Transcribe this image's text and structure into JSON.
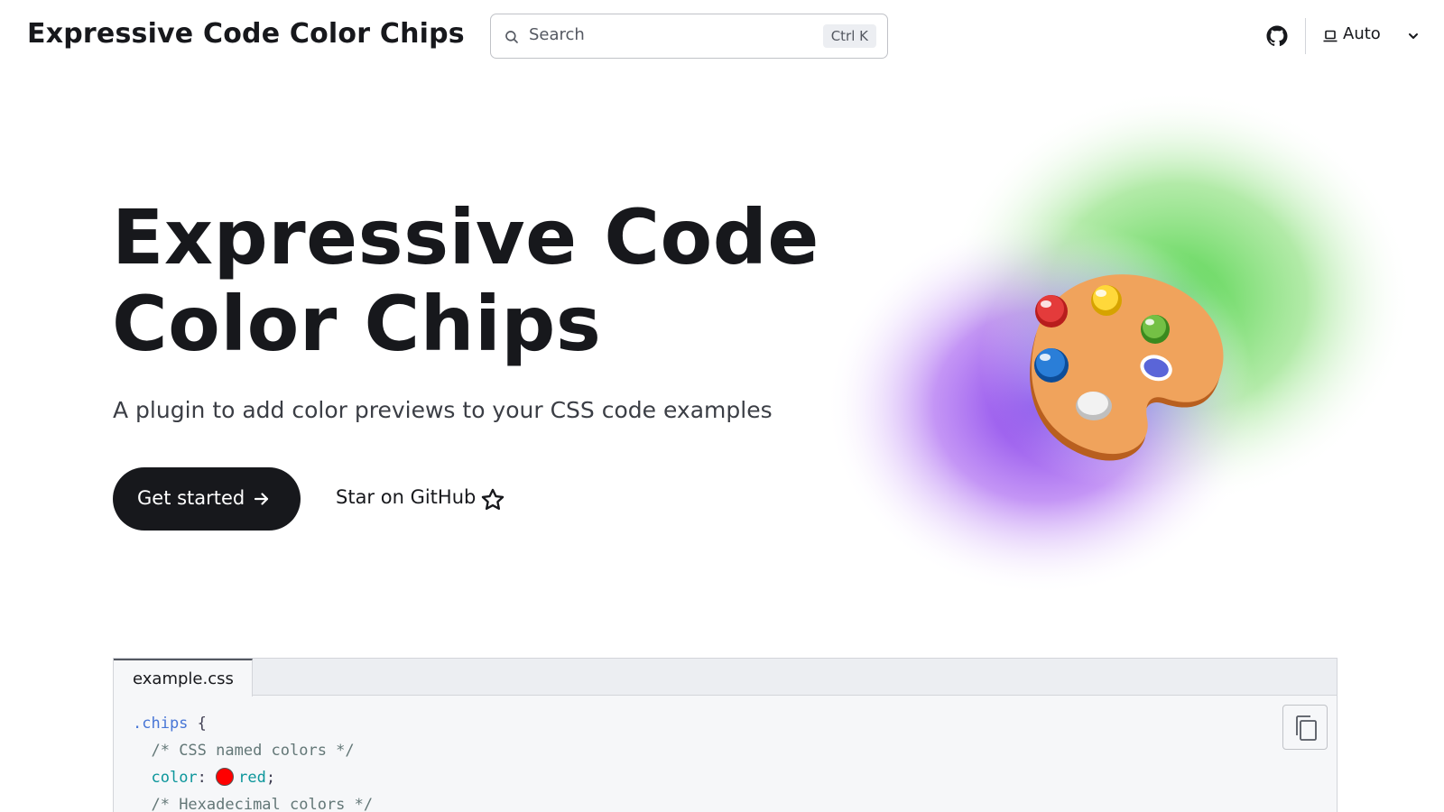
{
  "header": {
    "site_title": "Expressive Code Color Chips",
    "search": {
      "label": "Search",
      "shortcut": "Ctrl K"
    },
    "github_icon": "github-icon",
    "theme_select": {
      "label": "Auto",
      "icon": "laptop-icon",
      "chevron": "chevron-down-icon"
    }
  },
  "hero": {
    "title_line1": "Expressive Code",
    "title_line2": "Color Chips",
    "tagline": "A plugin to add color previews to your CSS code examples",
    "primary_action": {
      "label": "Get started",
      "icon": "arrow-right-icon"
    },
    "secondary_action": {
      "label": "Star on GitHub",
      "icon": "star-icon"
    },
    "image": {
      "icon": "artist-palette-icon"
    }
  },
  "code_example": {
    "tab_label": "example.css",
    "copy_icon": "copy-icon",
    "lines": {
      "l1_selector": ".chips",
      "l1_brace": " {",
      "l2_comment": "/* CSS named colors */",
      "l3_property": "color",
      "l3_colon": ": ",
      "l3_value": "red",
      "l3_semicolon": ";",
      "l4_comment": "/* Hexadecimal colors */"
    },
    "chip_color": "#ff0000"
  },
  "colors": {
    "text": "#17181c",
    "button_bg": "#17181c",
    "glow_green": "#5fd35a",
    "glow_purple": "#8e44ec"
  }
}
